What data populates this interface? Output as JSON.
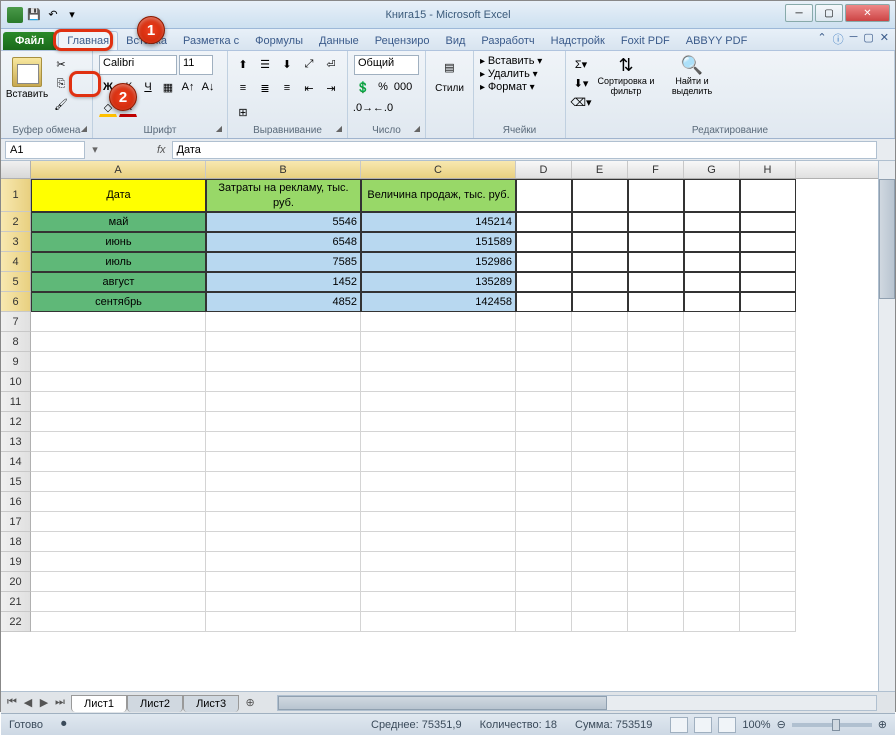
{
  "window": {
    "title": "Книга15 - Microsoft Excel"
  },
  "tabs": {
    "file": "Файл",
    "items": [
      "Главная",
      "Вставка",
      "Разметка с",
      "Формулы",
      "Данные",
      "Рецензиро",
      "Вид",
      "Разработч",
      "Надстройк",
      "Foxit PDF",
      "ABBYY PDF"
    ],
    "active_index": 0
  },
  "ribbon": {
    "clipboard": {
      "label": "Буфер обмена",
      "paste": "Вставить"
    },
    "font": {
      "label": "Шрифт",
      "name": "Calibri",
      "size": "11"
    },
    "alignment": {
      "label": "Выравнивание"
    },
    "number": {
      "label": "Число",
      "format": "Общий"
    },
    "styles": {
      "label": "Стили"
    },
    "cells": {
      "label": "Ячейки",
      "insert": "Вставить",
      "delete": "Удалить",
      "format": "Формат"
    },
    "editing": {
      "label": "Редактирование",
      "sort": "Сортировка и фильтр",
      "find": "Найти и выделить"
    }
  },
  "formula_bar": {
    "name_box": "A1",
    "formula": "Дата"
  },
  "columns": [
    "A",
    "B",
    "C",
    "D",
    "E",
    "F",
    "G",
    "H"
  ],
  "table": {
    "headers": [
      "Дата",
      "Затраты на рекламу, тыс. руб.",
      "Величина продаж, тыс. руб."
    ],
    "rows": [
      {
        "a": "май",
        "b": "5546",
        "c": "145214"
      },
      {
        "a": "июнь",
        "b": "6548",
        "c": "151589"
      },
      {
        "a": "июль",
        "b": "7585",
        "c": "152986"
      },
      {
        "a": "август",
        "b": "1452",
        "c": "135289"
      },
      {
        "a": "сентябрь",
        "b": "4852",
        "c": "142458"
      }
    ]
  },
  "sheets": {
    "items": [
      "Лист1",
      "Лист2",
      "Лист3"
    ],
    "active_index": 0
  },
  "statusbar": {
    "ready": "Готово",
    "average_label": "Среднее:",
    "average": "75351,9",
    "count_label": "Количество:",
    "count": "18",
    "sum_label": "Сумма:",
    "sum": "753519",
    "zoom": "100%"
  },
  "callouts": {
    "one": "1",
    "two": "2"
  }
}
